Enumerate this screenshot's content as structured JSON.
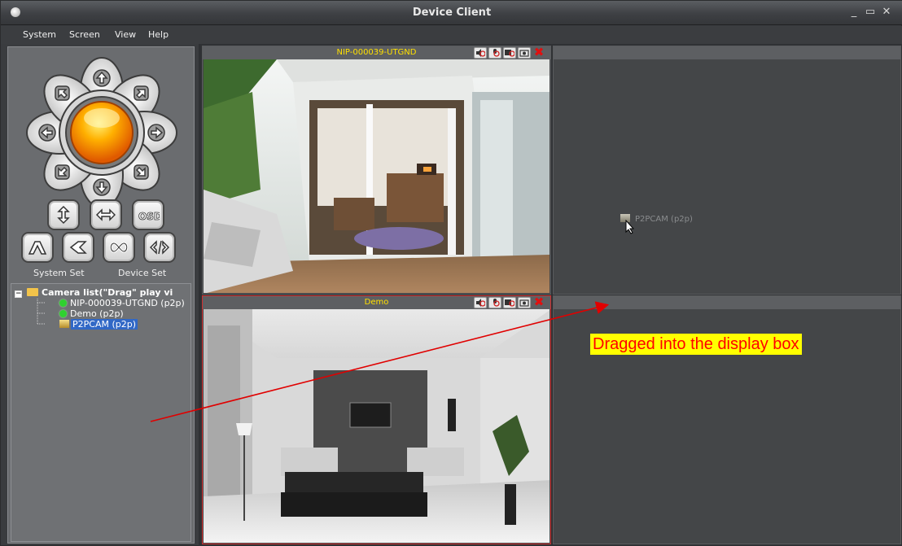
{
  "window": {
    "title": "Device Client"
  },
  "menu": [
    "System",
    "Screen",
    "View",
    "Help"
  ],
  "left_panel": {
    "system_set": "System Set",
    "device_set": "Device Set",
    "control_buttons": [
      "flip-vertical",
      "flip-horizontal",
      "OSD",
      "up-down-cruise",
      "left-right-cruise",
      "infinite-cruise",
      "stop-cruise"
    ],
    "osd_label": "OSD"
  },
  "tree": {
    "root": "Camera list(\"Drag\" play vi",
    "items": [
      {
        "label": "NIP-000039-UTGND (p2p)",
        "status": "online"
      },
      {
        "label": "Demo (p2p)",
        "status": "online"
      },
      {
        "label": "P2PCAM (p2p)",
        "status": "selected"
      }
    ]
  },
  "cells": [
    {
      "title": "NIP-000039-UTGND",
      "has_video": true
    },
    {
      "title": "",
      "has_video": false,
      "drag_label": "P2PCAM (p2p)"
    },
    {
      "title": "Demo",
      "has_video": true,
      "selected": true
    },
    {
      "title": "",
      "has_video": false
    }
  ],
  "annotation": {
    "callout": "Dragged into the display box"
  },
  "colors": {
    "title_yellow": "#ffe000",
    "selected_border": "#d03030",
    "online_green": "#2fd12f",
    "callout_bg": "#ffff00",
    "callout_text": "#ff0000"
  }
}
